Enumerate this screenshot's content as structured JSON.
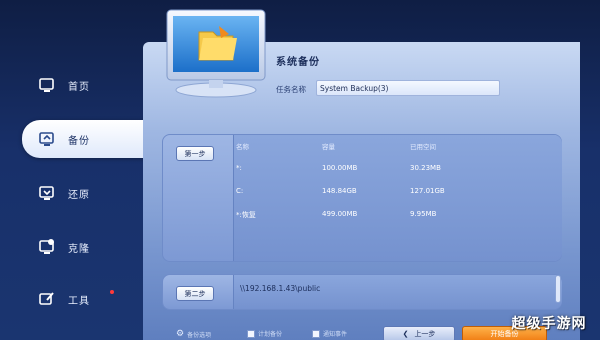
{
  "sidebar": {
    "items": [
      {
        "label": "首页",
        "icon": "home-icon"
      },
      {
        "label": "备份",
        "icon": "backup-icon",
        "active": true
      },
      {
        "label": "还原",
        "icon": "restore-icon"
      },
      {
        "label": "克隆",
        "icon": "clone-icon"
      },
      {
        "label": "工具",
        "icon": "tools-icon",
        "badge": true
      }
    ]
  },
  "header": {
    "title": "系统备份",
    "task_name_label": "任务名称",
    "task_name_value": "System Backup(3)"
  },
  "step1": {
    "button_label": "第一步",
    "columns": [
      "名称",
      "容量",
      "已用空间"
    ],
    "rows": [
      {
        "name": "*:",
        "capacity": "100.00MB",
        "used": "30.23MB"
      },
      {
        "name": "C:",
        "capacity": "148.84GB",
        "used": "127.01GB"
      },
      {
        "name": "*:恢复",
        "capacity": "499.00MB",
        "used": "9.95MB"
      }
    ]
  },
  "step2": {
    "button_label": "第二步",
    "destination": "\\\\192.168.1.43\\public"
  },
  "bottom": {
    "options": [
      "备份选项",
      "计划备份",
      "通知事件"
    ],
    "prev_label": "上一步",
    "start_label": "开始备份"
  },
  "watermark": "超级手游网",
  "colors": {
    "accent": "#f28a1e",
    "background": "#152a5e",
    "panel": "#9fb7e2"
  }
}
